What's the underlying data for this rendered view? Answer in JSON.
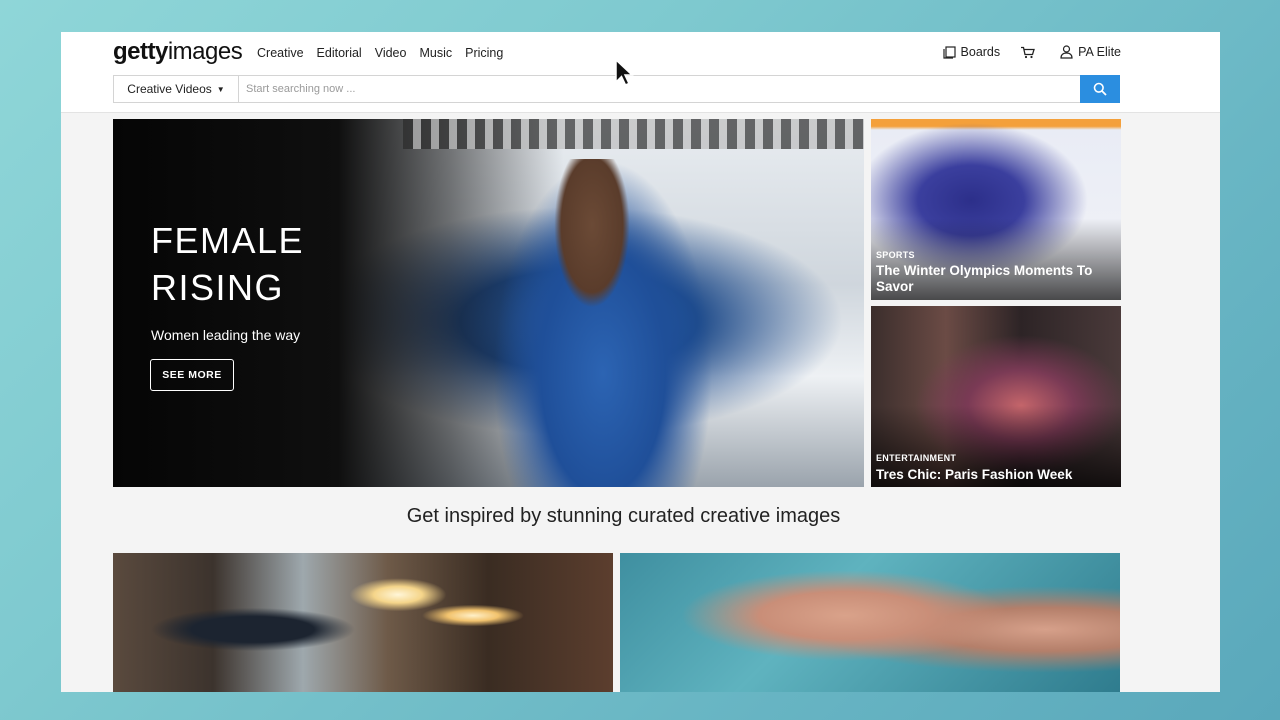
{
  "header": {
    "logo_part1": "getty",
    "logo_part2": "images",
    "nav": [
      "Creative",
      "Editorial",
      "Video",
      "Music",
      "Pricing"
    ],
    "boards_label": "Boards",
    "account_label": "PA Elite",
    "icons": {
      "boards": "boards-icon",
      "cart": "cart-icon",
      "user": "user-icon",
      "search": "search-icon"
    }
  },
  "search": {
    "category": "Creative Videos",
    "placeholder": "Start searching now ..."
  },
  "hero": {
    "title_line1": "FEMALE",
    "title_line2": "RISING",
    "subtitle": "Women leading the way",
    "button": "SEE MORE"
  },
  "cards": [
    {
      "category": "SPORTS",
      "title": "The Winter Olympics Moments To Savor"
    },
    {
      "category": "ENTERTAINMENT",
      "title": "Tres Chic: Paris Fashion Week"
    }
  ],
  "section_heading": "Get inspired by stunning curated creative images",
  "colors": {
    "accent": "#2b8ee0",
    "text": "#222222"
  }
}
